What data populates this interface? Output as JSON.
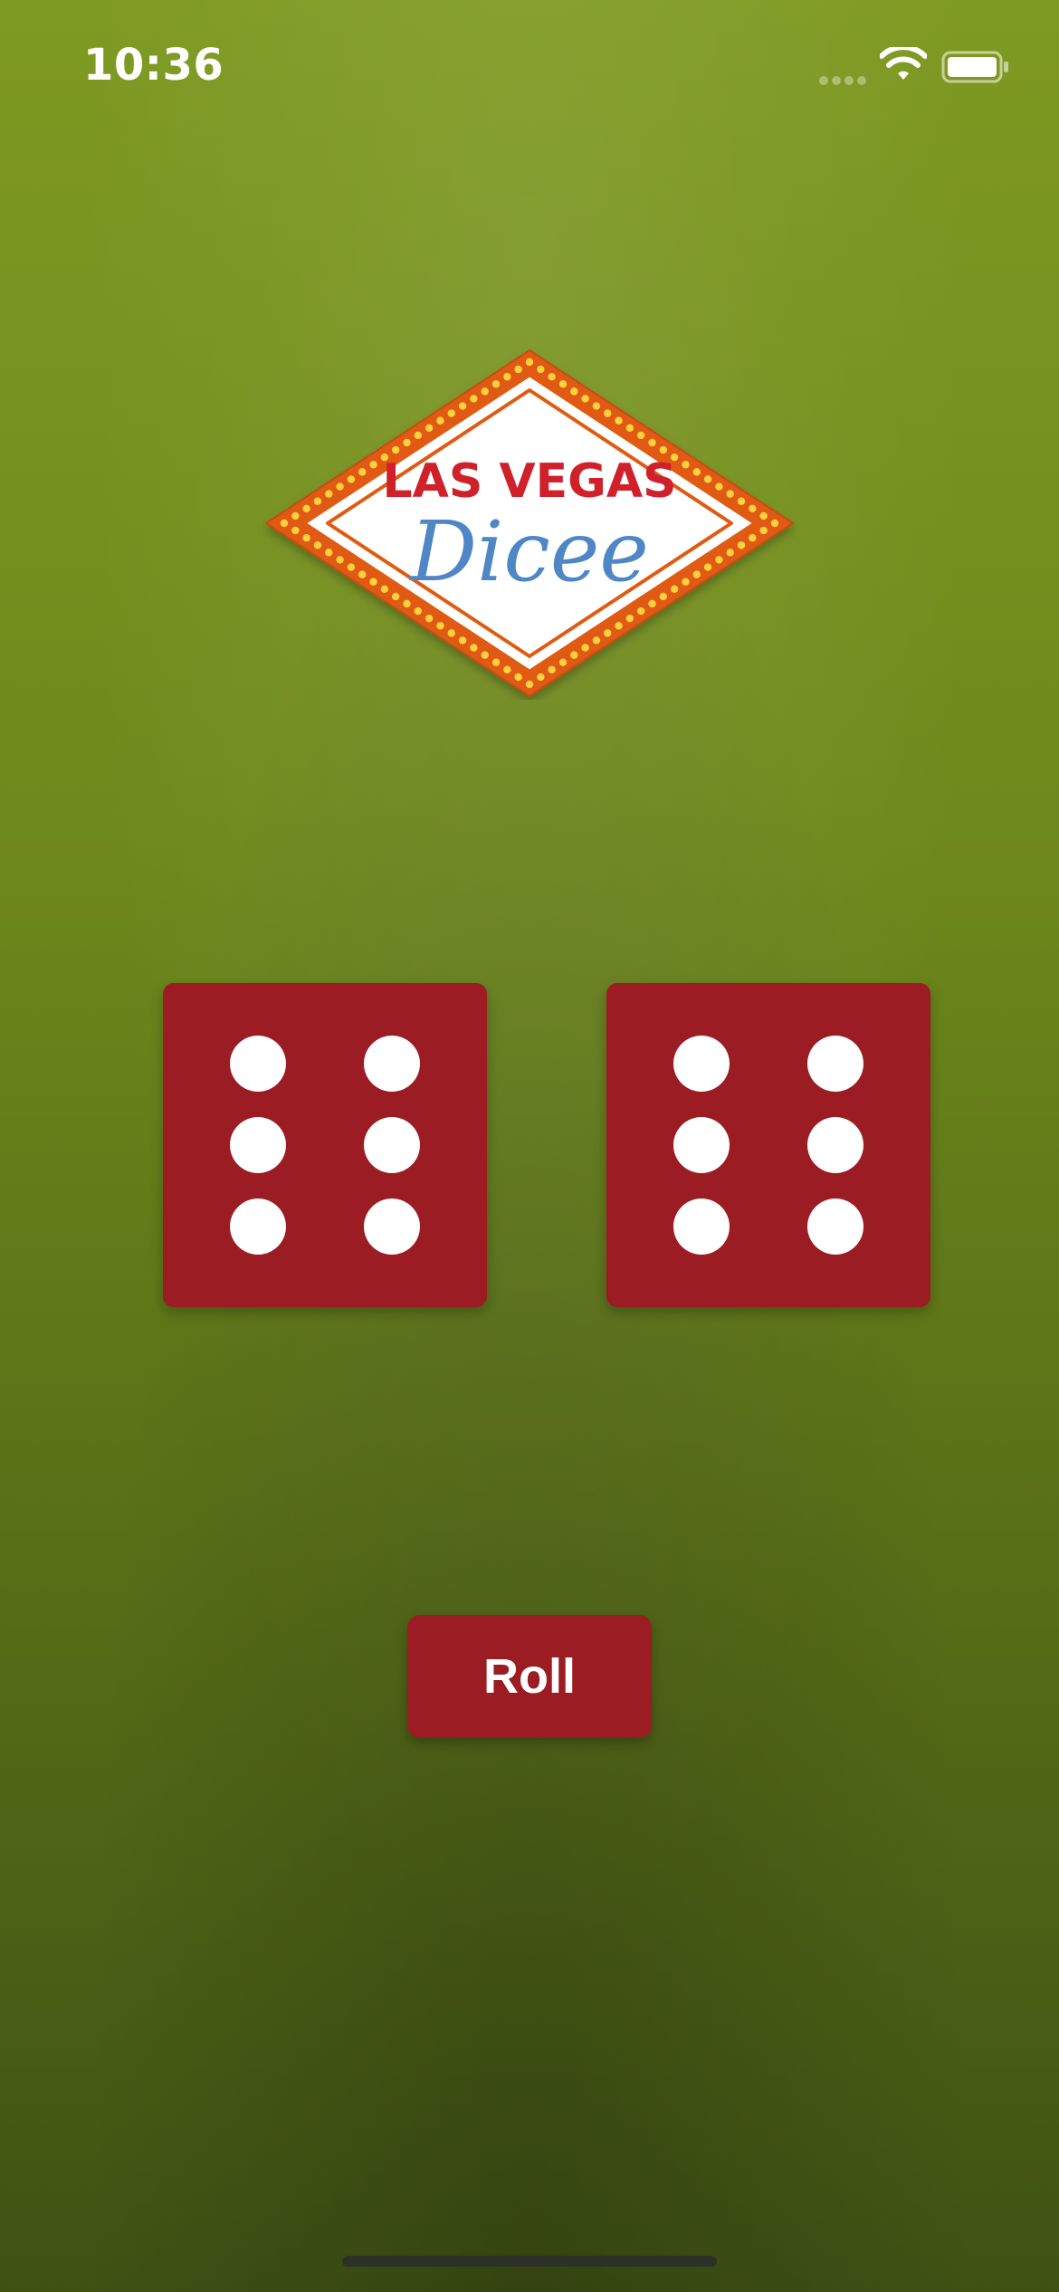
{
  "status_bar": {
    "time": "10:36",
    "icons": [
      "signal-dots-icon",
      "wifi-icon",
      "battery-icon"
    ]
  },
  "logo": {
    "line1": "LAS VEGAS",
    "line2": "Dicee",
    "colors": {
      "red_text": "#d0202a",
      "blue_script": "#4f86c6",
      "orange_frame": "#e05a12",
      "bulb": "#ffd23a"
    }
  },
  "dice": {
    "left": {
      "value": 6
    },
    "right": {
      "value": 6
    }
  },
  "roll_button": {
    "label": "Roll"
  },
  "colors": {
    "felt_top": "#7f9a22",
    "felt_bottom": "#3f5214",
    "dice_red": "#9b1c22",
    "pip_white": "#ffffff"
  }
}
